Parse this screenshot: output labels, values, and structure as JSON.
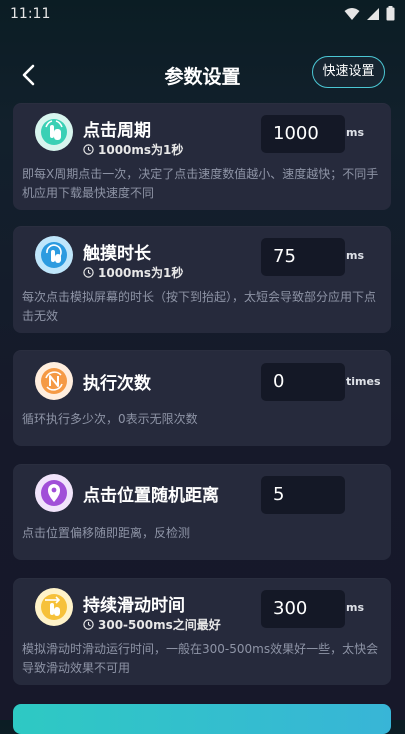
{
  "status": {
    "time": "11:11"
  },
  "header": {
    "title": "参数设置",
    "quick_label": "快速设置"
  },
  "cards": [
    {
      "title": "点击周期",
      "hint": "1000ms为1秒",
      "value": "1000",
      "unit": "ms",
      "desc": "即每X周期点击一次，决定了点击速度数值越小、速度越快；不同手机应用下载最快速度不同"
    },
    {
      "title": "触摸时长",
      "hint": "1000ms为1秒",
      "value": "75",
      "unit": "ms",
      "desc": "每次点击模拟屏幕的时长（按下到抬起），太短会导致部分应用下点击无效"
    },
    {
      "title": "执行次数",
      "hint": "",
      "value": "0",
      "unit": "times",
      "desc": "循环执行多少次，0表示无限次数"
    },
    {
      "title": "点击位置随机距离",
      "hint": "",
      "value": "5",
      "unit": "",
      "desc": "点击位置偏移随即距离，反检测"
    },
    {
      "title": "持续滑动时间",
      "hint": "300-500ms之间最好",
      "value": "300",
      "unit": "ms",
      "desc": "模拟滑动时滑动运行时间，一般在300-500ms效果好一些，太快会导致滑动效果不可用"
    }
  ],
  "icons": {
    "card1": "tap-hand-icon",
    "card2": "touch-duration-icon",
    "card3": "repeat-count-icon",
    "card4": "location-pin-icon",
    "card5": "swipe-hand-icon",
    "hint": "clock-icon"
  },
  "colors": {
    "accent": "#4bc7d4",
    "card_bg": "#262a3c",
    "input_bg": "#141826",
    "icon1_bg": "#d7f5ee",
    "icon2_bg": "#bfe6fb",
    "icon3_bg": "#ffeede",
    "icon4_bg": "#f1e4fb",
    "icon5_bg": "#fff3c9"
  }
}
